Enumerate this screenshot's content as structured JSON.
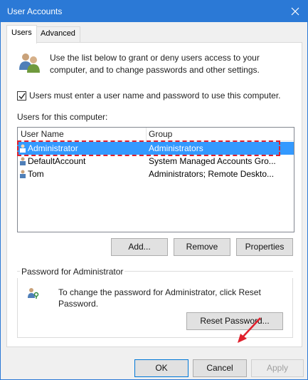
{
  "window": {
    "title": "User Accounts",
    "close_icon": "close-icon"
  },
  "tabs": [
    {
      "label": "Users",
      "active": true
    },
    {
      "label": "Advanced",
      "active": false
    }
  ],
  "intro": {
    "icon": "users-icon",
    "text": "Use the list below to grant or deny users access to your computer, and to change passwords and other settings."
  },
  "must_login": {
    "label": "Users must enter a user name and password to use this computer.",
    "checked": true
  },
  "users_list": {
    "label": "Users for this computer:",
    "columns": [
      "User Name",
      "Group"
    ],
    "rows": [
      {
        "name": "Administrator",
        "group": "Administrators",
        "selected": true
      },
      {
        "name": "DefaultAccount",
        "group": "System Managed Accounts Gro...",
        "selected": false
      },
      {
        "name": "Tom",
        "group": "Administrators; Remote Deskto...",
        "selected": false
      }
    ]
  },
  "list_buttons": {
    "add": "Add...",
    "remove": "Remove",
    "properties": "Properties"
  },
  "password_group": {
    "label": "Password for Administrator",
    "icon": "key-user-icon",
    "text": "To change the password for Administrator, click Reset Password.",
    "reset_button": "Reset Password..."
  },
  "dialog_buttons": {
    "ok": "OK",
    "cancel": "Cancel",
    "apply": "Apply"
  },
  "colors": {
    "title_bar": "#2b79d6",
    "selection": "#3399ff",
    "highlight_outline": "#e0202c"
  }
}
